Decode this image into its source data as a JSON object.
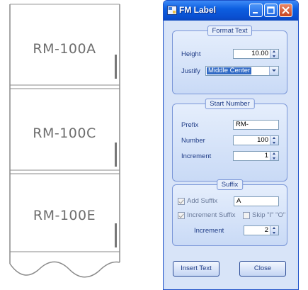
{
  "drawing": {
    "labels": [
      "RM-100A",
      "RM-100C",
      "RM-100E"
    ]
  },
  "window": {
    "title": "FM Label"
  },
  "format_text": {
    "legend": "Format Text",
    "height_label": "Height",
    "height_value": "10.00",
    "justify_label": "Justify",
    "justify_value": "Middle Center"
  },
  "start_number": {
    "legend": "Start Number",
    "prefix_label": "Prefix",
    "prefix_value": "RM-",
    "number_label": "Number",
    "number_value": "100",
    "increment_label": "Increment",
    "increment_value": "1"
  },
  "suffix": {
    "legend": "Suffix",
    "add_suffix_label": "Add Suffix",
    "add_suffix_checked": true,
    "suffix_value": "A",
    "increment_suffix_label": "Increment Suffix",
    "increment_suffix_checked": true,
    "skip_label": "Skip \"I\" \"O\"",
    "skip_checked": false,
    "increment_label": "Increment",
    "increment_value": "2"
  },
  "buttons": {
    "insert_text": "Insert Text",
    "close": "Close"
  },
  "colors": {
    "titlebar": "#0a4ed0",
    "group_border": "#7a96d8",
    "label_text": "#1f3c86"
  }
}
